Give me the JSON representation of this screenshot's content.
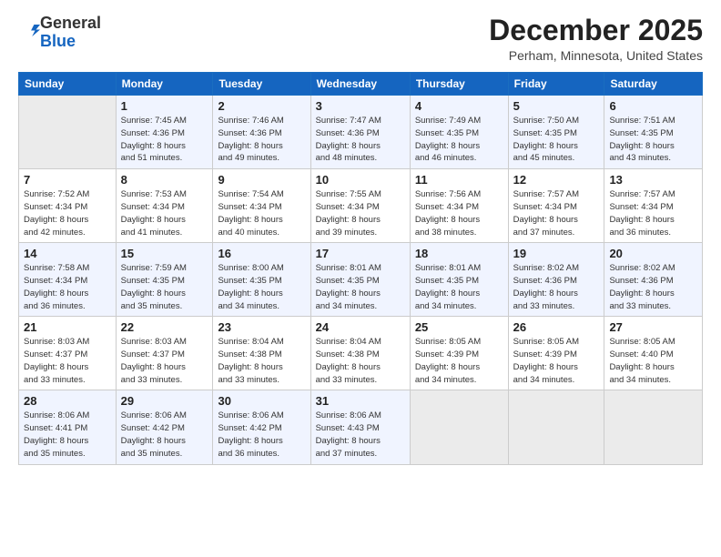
{
  "header": {
    "logo_general": "General",
    "logo_blue": "Blue",
    "month_title": "December 2025",
    "location": "Perham, Minnesota, United States"
  },
  "weekdays": [
    "Sunday",
    "Monday",
    "Tuesday",
    "Wednesday",
    "Thursday",
    "Friday",
    "Saturday"
  ],
  "weeks": [
    [
      {
        "day": "",
        "info": ""
      },
      {
        "day": "1",
        "info": "Sunrise: 7:45 AM\nSunset: 4:36 PM\nDaylight: 8 hours\nand 51 minutes."
      },
      {
        "day": "2",
        "info": "Sunrise: 7:46 AM\nSunset: 4:36 PM\nDaylight: 8 hours\nand 49 minutes."
      },
      {
        "day": "3",
        "info": "Sunrise: 7:47 AM\nSunset: 4:36 PM\nDaylight: 8 hours\nand 48 minutes."
      },
      {
        "day": "4",
        "info": "Sunrise: 7:49 AM\nSunset: 4:35 PM\nDaylight: 8 hours\nand 46 minutes."
      },
      {
        "day": "5",
        "info": "Sunrise: 7:50 AM\nSunset: 4:35 PM\nDaylight: 8 hours\nand 45 minutes."
      },
      {
        "day": "6",
        "info": "Sunrise: 7:51 AM\nSunset: 4:35 PM\nDaylight: 8 hours\nand 43 minutes."
      }
    ],
    [
      {
        "day": "7",
        "info": "Sunrise: 7:52 AM\nSunset: 4:34 PM\nDaylight: 8 hours\nand 42 minutes."
      },
      {
        "day": "8",
        "info": "Sunrise: 7:53 AM\nSunset: 4:34 PM\nDaylight: 8 hours\nand 41 minutes."
      },
      {
        "day": "9",
        "info": "Sunrise: 7:54 AM\nSunset: 4:34 PM\nDaylight: 8 hours\nand 40 minutes."
      },
      {
        "day": "10",
        "info": "Sunrise: 7:55 AM\nSunset: 4:34 PM\nDaylight: 8 hours\nand 39 minutes."
      },
      {
        "day": "11",
        "info": "Sunrise: 7:56 AM\nSunset: 4:34 PM\nDaylight: 8 hours\nand 38 minutes."
      },
      {
        "day": "12",
        "info": "Sunrise: 7:57 AM\nSunset: 4:34 PM\nDaylight: 8 hours\nand 37 minutes."
      },
      {
        "day": "13",
        "info": "Sunrise: 7:57 AM\nSunset: 4:34 PM\nDaylight: 8 hours\nand 36 minutes."
      }
    ],
    [
      {
        "day": "14",
        "info": "Sunrise: 7:58 AM\nSunset: 4:34 PM\nDaylight: 8 hours\nand 36 minutes."
      },
      {
        "day": "15",
        "info": "Sunrise: 7:59 AM\nSunset: 4:35 PM\nDaylight: 8 hours\nand 35 minutes."
      },
      {
        "day": "16",
        "info": "Sunrise: 8:00 AM\nSunset: 4:35 PM\nDaylight: 8 hours\nand 34 minutes."
      },
      {
        "day": "17",
        "info": "Sunrise: 8:01 AM\nSunset: 4:35 PM\nDaylight: 8 hours\nand 34 minutes."
      },
      {
        "day": "18",
        "info": "Sunrise: 8:01 AM\nSunset: 4:35 PM\nDaylight: 8 hours\nand 34 minutes."
      },
      {
        "day": "19",
        "info": "Sunrise: 8:02 AM\nSunset: 4:36 PM\nDaylight: 8 hours\nand 33 minutes."
      },
      {
        "day": "20",
        "info": "Sunrise: 8:02 AM\nSunset: 4:36 PM\nDaylight: 8 hours\nand 33 minutes."
      }
    ],
    [
      {
        "day": "21",
        "info": "Sunrise: 8:03 AM\nSunset: 4:37 PM\nDaylight: 8 hours\nand 33 minutes."
      },
      {
        "day": "22",
        "info": "Sunrise: 8:03 AM\nSunset: 4:37 PM\nDaylight: 8 hours\nand 33 minutes."
      },
      {
        "day": "23",
        "info": "Sunrise: 8:04 AM\nSunset: 4:38 PM\nDaylight: 8 hours\nand 33 minutes."
      },
      {
        "day": "24",
        "info": "Sunrise: 8:04 AM\nSunset: 4:38 PM\nDaylight: 8 hours\nand 33 minutes."
      },
      {
        "day": "25",
        "info": "Sunrise: 8:05 AM\nSunset: 4:39 PM\nDaylight: 8 hours\nand 34 minutes."
      },
      {
        "day": "26",
        "info": "Sunrise: 8:05 AM\nSunset: 4:39 PM\nDaylight: 8 hours\nand 34 minutes."
      },
      {
        "day": "27",
        "info": "Sunrise: 8:05 AM\nSunset: 4:40 PM\nDaylight: 8 hours\nand 34 minutes."
      }
    ],
    [
      {
        "day": "28",
        "info": "Sunrise: 8:06 AM\nSunset: 4:41 PM\nDaylight: 8 hours\nand 35 minutes."
      },
      {
        "day": "29",
        "info": "Sunrise: 8:06 AM\nSunset: 4:42 PM\nDaylight: 8 hours\nand 35 minutes."
      },
      {
        "day": "30",
        "info": "Sunrise: 8:06 AM\nSunset: 4:42 PM\nDaylight: 8 hours\nand 36 minutes."
      },
      {
        "day": "31",
        "info": "Sunrise: 8:06 AM\nSunset: 4:43 PM\nDaylight: 8 hours\nand 37 minutes."
      },
      {
        "day": "",
        "info": ""
      },
      {
        "day": "",
        "info": ""
      },
      {
        "day": "",
        "info": ""
      }
    ]
  ]
}
